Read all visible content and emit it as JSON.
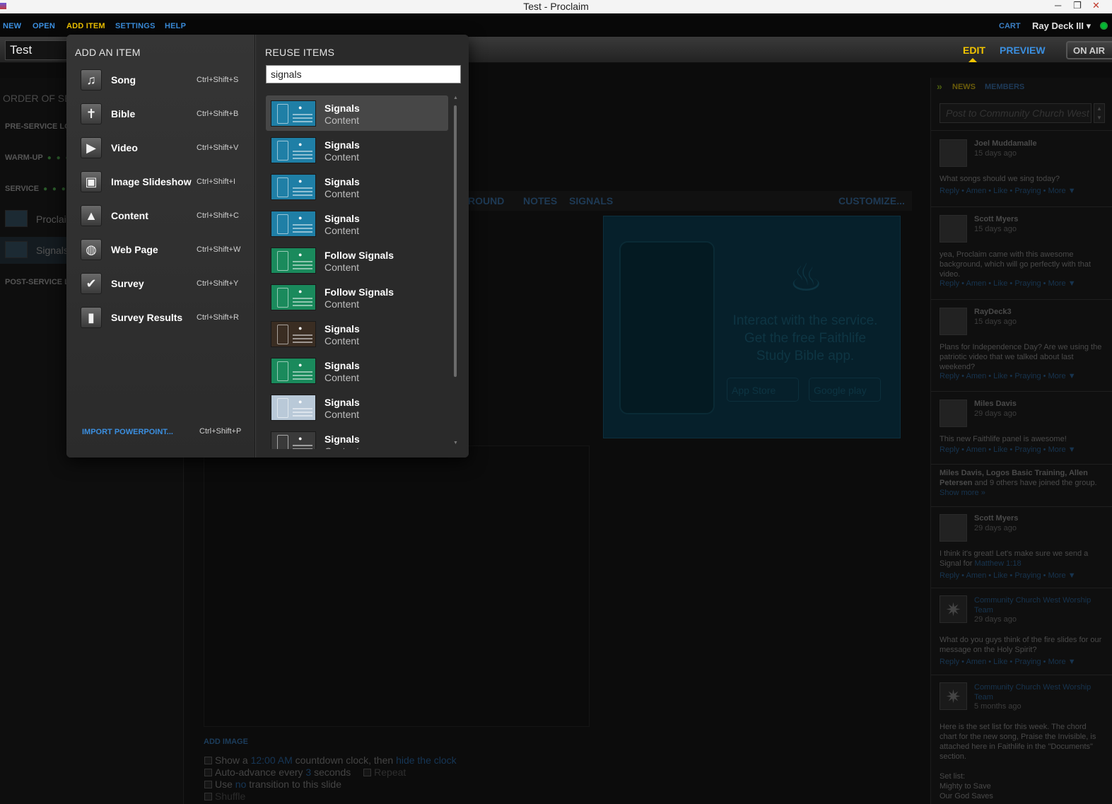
{
  "window": {
    "title": "Test - Proclaim",
    "min": "─",
    "max": "❐",
    "close": "✕"
  },
  "menubar": {
    "items": [
      "NEW",
      "OPEN",
      "ADD ITEM",
      "SETTINGS",
      "HELP"
    ],
    "cart": "CART",
    "user": "Ray Deck III ▾"
  },
  "toolbar": {
    "doc_title": "Test",
    "edit": "EDIT",
    "preview": "PREVIEW",
    "on_air": "ON AIR"
  },
  "order": {
    "heading": "ORDER OF SER",
    "pre_service": "PRE-SERVICE LO",
    "warm_up": "WARM-UP",
    "service": "SERVICE",
    "post_service": "POST-SERVICE LO",
    "items": [
      "Proclai",
      "Signals"
    ]
  },
  "main": {
    "tabs": [
      "ROUND",
      "NOTES",
      "SIGNALS",
      "CUSTOMIZE..."
    ],
    "preview_text": "Interact with the service. Get the free Faithlife Study Bible app.",
    "badge_app_store": "App Store",
    "badge_play": "Google play",
    "add_image": "ADD IMAGE",
    "opt1": {
      "pre": "Show a ",
      "time": "12:00 AM",
      "mid": " countdown clock, then ",
      "link": "hide the clock"
    },
    "opt2": {
      "pre": "Auto-advance every ",
      "num": "3",
      "post": " seconds",
      "repeat": "Repeat"
    },
    "opt3": {
      "pre": "Use ",
      "link": "no",
      "post": " transition to this slide"
    },
    "opt4": "Shuffle"
  },
  "sidebar": {
    "tab_news": "NEWS",
    "tab_members": "MEMBERS",
    "post_placeholder": "Post to Community Church West Worship Team",
    "actions": "Reply • Amen • Like • Praying • More ▼",
    "posts": [
      {
        "name": "Joel Muddamalle",
        "age": "15 days ago",
        "body": "What songs should we sing today?"
      },
      {
        "name": "Scott Myers",
        "age": "15 days ago",
        "body": "yea, Proclaim came with this awesome background, which will go perfectly with that video."
      },
      {
        "name": "RayDeck3",
        "age": "15 days ago",
        "body": "Plans for Independence Day? Are we using the patriotic video that we talked about last weekend?"
      },
      {
        "name": "Miles Davis",
        "age": "29 days ago",
        "body": "This new Faithlife panel is awesome!"
      },
      {
        "name": "Scott Myers",
        "age": "29 days ago",
        "body": "I think it's great! Let's make sure we send a Signal for ",
        "link": "Matthew 1:18"
      },
      {
        "name": "Community Church West Worship Team",
        "age": "29 days ago",
        "body": "What do you guys think of the fire slides for our message on the Holy Spirit?"
      },
      {
        "name": "Community Church West Worship Team",
        "age": "5 months ago",
        "body": "Here is the set list for this week. The chord chart for the new song, Praise the Invisible, is attached here in Faithlife in the \"Documents\" section.",
        "setlist": [
          "Set list:",
          "Mighty to Save",
          "Our God Saves"
        ]
      }
    ],
    "joined": {
      "names": "Miles Davis, Logos Basic Training, Allen Petersen",
      "rest": " and 9 others have joined the group. ",
      "link": "Show more »"
    }
  },
  "panel": {
    "add_heading": "ADD AN ITEM",
    "reuse_heading": "REUSE ITEMS",
    "search_value": "signals",
    "add_items": [
      {
        "label": "Song",
        "shortcut": "Ctrl+Shift+S",
        "icon": "music-note-icon"
      },
      {
        "label": "Bible",
        "shortcut": "Ctrl+Shift+B",
        "icon": "cross-icon"
      },
      {
        "label": "Video",
        "shortcut": "Ctrl+Shift+V",
        "icon": "film-icon"
      },
      {
        "label": "Image Slideshow",
        "shortcut": "Ctrl+Shift+I",
        "icon": "photos-icon"
      },
      {
        "label": "Content",
        "shortcut": "Ctrl+Shift+C",
        "icon": "content-image-icon"
      },
      {
        "label": "Web Page",
        "shortcut": "Ctrl+Shift+W",
        "icon": "globe-icon"
      },
      {
        "label": "Survey",
        "shortcut": "Ctrl+Shift+Y",
        "icon": "checkmark-icon"
      },
      {
        "label": "Survey Results",
        "shortcut": "Ctrl+Shift+R",
        "icon": "bar-chart-icon"
      }
    ],
    "import_label": "IMPORT POWERPOINT...",
    "import_shortcut": "Ctrl+Shift+P",
    "results": [
      {
        "title": "Signals",
        "type": "Content",
        "color": "#1f7fa6"
      },
      {
        "title": "Signals",
        "type": "Content",
        "color": "#1f7fa6"
      },
      {
        "title": "Signals",
        "type": "Content",
        "color": "#1f7fa6"
      },
      {
        "title": "Signals",
        "type": "Content",
        "color": "#1f7fa6"
      },
      {
        "title": "Follow Signals",
        "type": "Content",
        "color": "#1a8a5c"
      },
      {
        "title": "Follow Signals",
        "type": "Content",
        "color": "#1a8a5c"
      },
      {
        "title": "Signals",
        "type": "Content",
        "color": "#3a2d22"
      },
      {
        "title": "Signals",
        "type": "Content",
        "color": "#1a8a5c"
      },
      {
        "title": "Signals",
        "type": "Content",
        "color": "#b9c9d8"
      },
      {
        "title": "Signals",
        "type": "Content",
        "color": "#3a3a3a"
      }
    ]
  },
  "colors": {
    "accent_blue": "#3b8fe0",
    "accent_yellow": "#f2c500",
    "status_green": "#1a9a33"
  }
}
